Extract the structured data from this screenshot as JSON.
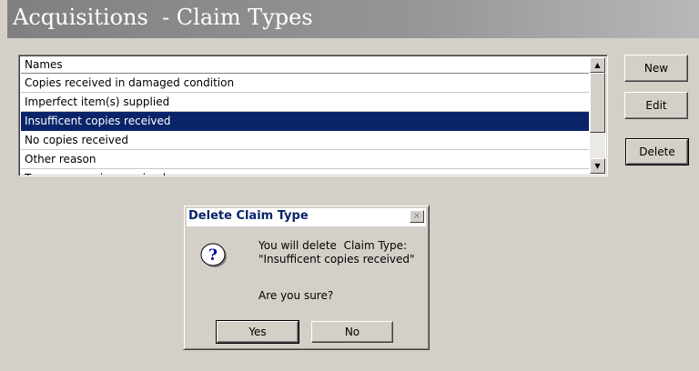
{
  "header": {
    "title": "Acquisitions  - Claim Types"
  },
  "list": {
    "column_header": "Names",
    "rows": [
      "Copies received in damaged condition",
      "Imperfect item(s) supplied",
      "Insufficent copies received",
      "No copies received",
      "Other reason",
      "Too many copies received"
    ],
    "selected_index": 2
  },
  "buttons": {
    "new": "New",
    "edit": "Edit",
    "delete": "Delete"
  },
  "dialog": {
    "title": "Delete  Claim Type",
    "close": "×",
    "message_line1": "You will delete  Claim Type:",
    "message_line2": "\"Insufficent copies received\"",
    "question": "Are you sure?",
    "yes": "Yes",
    "no": "No"
  },
  "colors": {
    "selection": "#0a246a",
    "face": "#d4d0c8",
    "title_gradient_start": "#808080"
  },
  "icons": {
    "dialog_icon": "question-icon",
    "scroll_up": "arrow-up-icon",
    "scroll_down": "arrow-down-icon"
  }
}
